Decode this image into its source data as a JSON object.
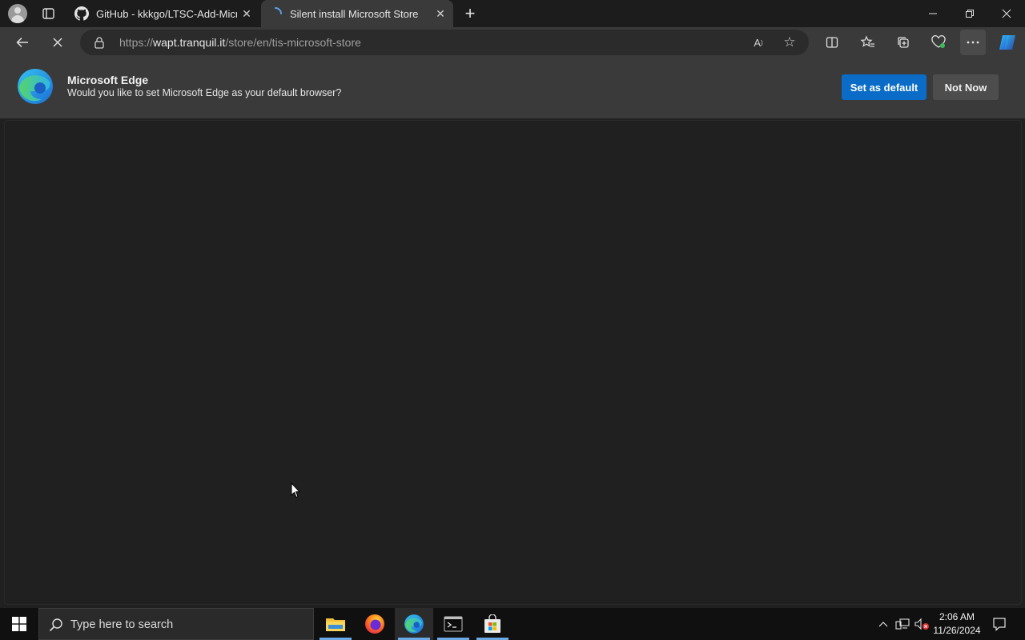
{
  "browser": {
    "tabs": [
      {
        "title": "GitHub - kkkgo/LTSC-Add-Microsoft-Store",
        "favicon": "github-icon",
        "active": false
      },
      {
        "title": "Silent install Microsoft Store",
        "favicon": "loading-spinner-icon",
        "active": true
      }
    ],
    "address": {
      "scheme": "https://",
      "host": "wapt.tranquil.it",
      "path": "/store/en/tis-microsoft-store"
    }
  },
  "infobar": {
    "title": "Microsoft Edge",
    "message": "Would you like to set Microsoft Edge as your default browser?",
    "primary_button": "Set as default",
    "secondary_button": "Not Now"
  },
  "taskbar": {
    "search_placeholder": "Type here to search",
    "apps": [
      "file-explorer-icon",
      "firefox-icon",
      "edge-icon",
      "terminal-icon",
      "microsoft-store-icon"
    ],
    "time": "2:06 AM",
    "date": "11/26/2024"
  },
  "colors": {
    "accent": "#0a6cc7",
    "toolbar": "#3a3a3a",
    "page": "#202020",
    "taskbar": "#101010"
  }
}
